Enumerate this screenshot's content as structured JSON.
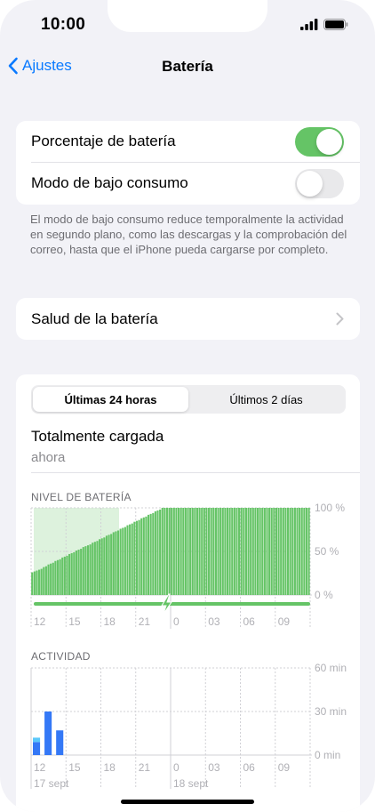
{
  "status": {
    "time": "10:00"
  },
  "nav": {
    "back_label": "Ajustes",
    "title": "Batería"
  },
  "settings": {
    "battery_percentage": {
      "label": "Porcentaje de batería",
      "on": true
    },
    "low_power": {
      "label": "Modo de bajo consumo",
      "on": false
    },
    "footnote": "El modo de bajo consumo reduce temporalmente la actividad en segundo plano, como las descargas y la comprobación del correo, hasta que el iPhone pueda cargarse por completo.",
    "health_label": "Salud de la batería"
  },
  "usage": {
    "segments": [
      "Últimas 24 horas",
      "Últimos 2 días"
    ],
    "status_title": "Totalmente cargada",
    "status_sub": "ahora"
  },
  "colors": {
    "accent": "#0a7aff",
    "green": "#65c466",
    "bar_blue": "#3478f6",
    "bar_teal": "#5ac8fa"
  },
  "chart_data": [
    {
      "type": "bar",
      "title": "NIVEL DE BATERÍA",
      "x_ticks": [
        "12",
        "15",
        "18",
        "21",
        "0",
        "03",
        "06",
        "09"
      ],
      "y_ticks": [
        "100 %",
        "50 %",
        "0 %"
      ],
      "ylim": [
        0,
        100
      ],
      "grid": true,
      "charging_icon": "bolt-icon",
      "values": [
        26,
        27,
        28,
        29,
        30,
        32,
        33,
        35,
        36,
        37,
        39,
        40,
        41,
        43,
        44,
        45,
        47,
        48,
        49,
        51,
        52,
        53,
        55,
        56,
        57,
        58,
        60,
        61,
        62,
        64,
        65,
        66,
        68,
        69,
        70,
        72,
        73,
        74,
        76,
        77,
        78,
        80,
        81,
        82,
        84,
        85,
        86,
        88,
        89,
        90,
        92,
        93,
        94,
        96,
        97,
        98,
        100,
        100,
        100,
        100,
        100,
        100,
        100,
        100,
        100,
        100,
        100,
        100,
        100,
        100,
        100,
        100,
        100,
        100,
        100,
        100,
        100,
        100,
        100,
        100,
        100,
        100,
        100,
        100,
        100,
        100,
        100,
        100,
        100,
        100,
        100,
        100,
        100,
        100,
        100,
        100,
        100,
        100,
        100,
        100,
        100,
        100,
        100,
        100,
        100,
        100,
        100,
        100,
        100,
        100,
        100,
        100,
        100,
        100,
        100,
        100,
        100,
        100,
        100,
        100
      ]
    },
    {
      "type": "bar",
      "title": "ACTIVIDAD",
      "x_ticks": [
        "12",
        "15",
        "18",
        "21",
        "0",
        "03",
        "06",
        "09"
      ],
      "date_labels": [
        "17 sept",
        "18 sept"
      ],
      "y_ticks": [
        "60 min",
        "30 min",
        "0 min"
      ],
      "ylim": [
        0,
        60
      ],
      "grid": true,
      "series": [
        {
          "values": [
            9,
            30,
            17,
            0,
            0,
            0,
            0,
            0,
            0,
            0,
            0,
            0,
            0,
            0,
            0,
            0,
            0,
            0,
            0,
            0,
            0,
            0,
            0,
            0
          ]
        },
        {
          "values": [
            3,
            0,
            0,
            0,
            0,
            0,
            0,
            0,
            0,
            0,
            0,
            0,
            0,
            0,
            0,
            0,
            0,
            0,
            0,
            0,
            0,
            0,
            0,
            0
          ]
        }
      ]
    }
  ]
}
